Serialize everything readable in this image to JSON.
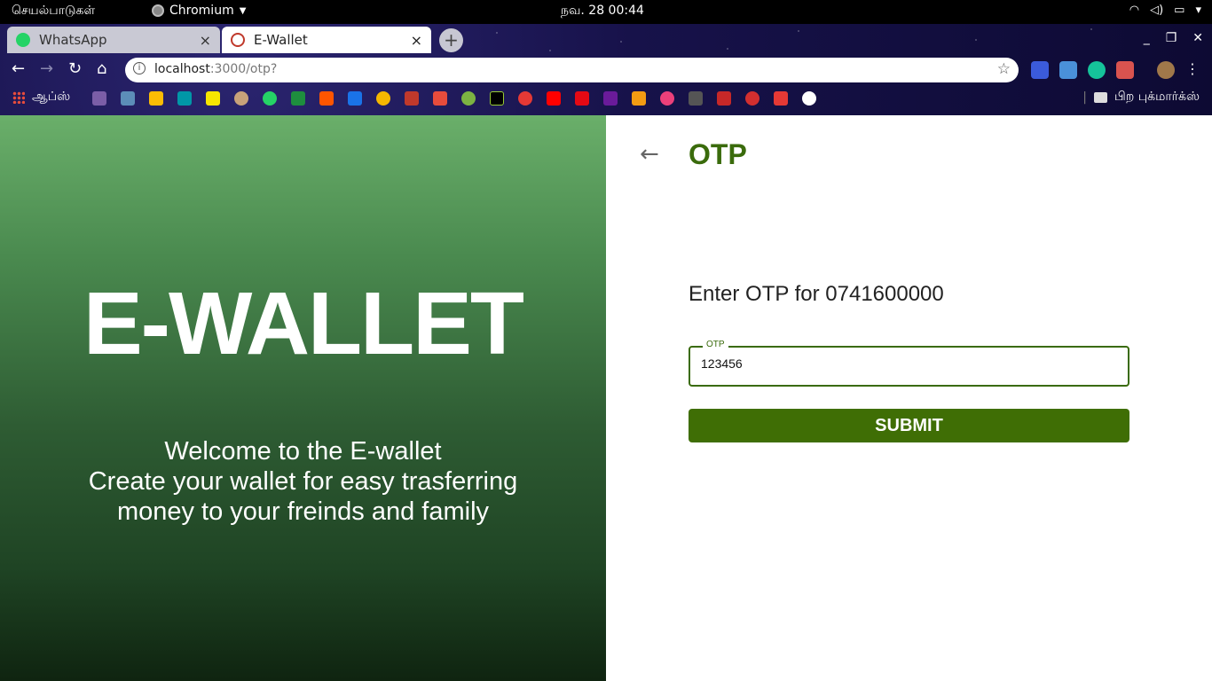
{
  "system_bar": {
    "activities": "செயல்பாடுகள்",
    "app_name": "Chromium",
    "clock": "நவ. 28  00:44"
  },
  "browser": {
    "tabs": [
      {
        "title": "WhatsApp",
        "close": "×"
      },
      {
        "title": "E-Wallet",
        "close": "×"
      }
    ],
    "new_tab": "+",
    "url_host": "localhost",
    "url_rest": ":3000/otp?",
    "bookmarks_apps_label": "ஆப்ஸ்",
    "other_bookmarks_label": "பிற புக்மார்க்ஸ்",
    "colors": {
      "frame": "#17124a"
    }
  },
  "left_panel": {
    "brand": "E-WALLET",
    "welcome_line1": "Welcome to the E-wallet",
    "welcome_line2": "Create your wallet for easy trasferring",
    "welcome_line3": "money to your freinds and family"
  },
  "form": {
    "back_icon": "arrow-left",
    "title": "OTP",
    "prompt": "Enter OTP for 0741600000",
    "otp_label": "OTP",
    "otp_value": "123456",
    "submit_label": "SUBMIT",
    "accent": "#3f6e05"
  }
}
